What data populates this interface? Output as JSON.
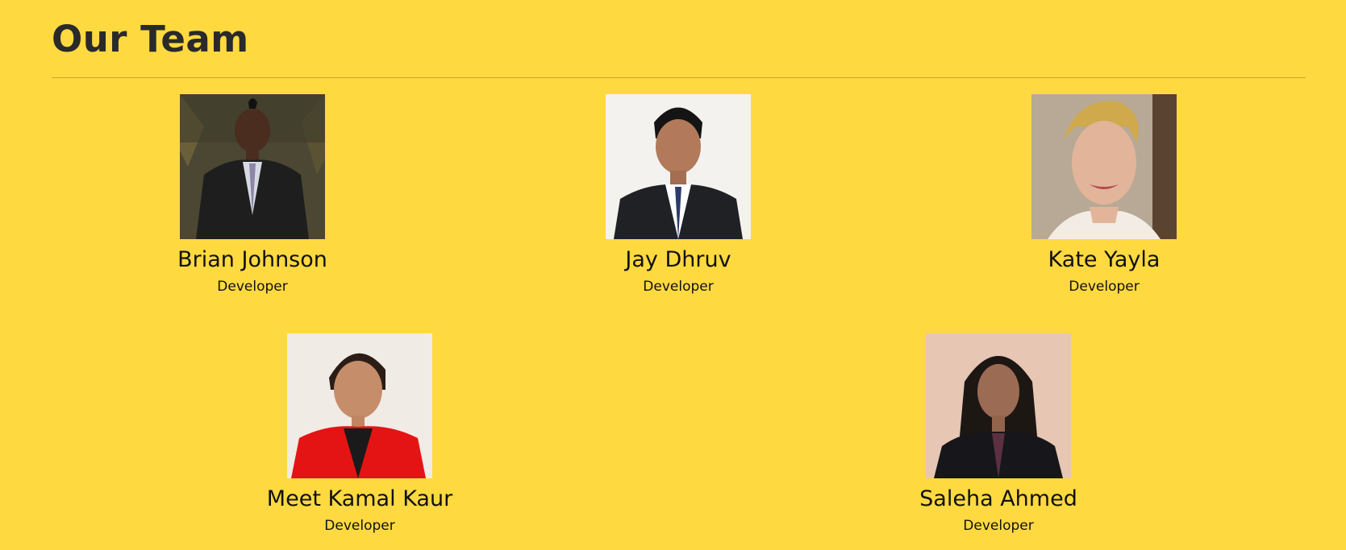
{
  "page": {
    "title": "Our Team",
    "background": "#ffd940"
  },
  "team": {
    "members": [
      {
        "name": "Brian Johnson",
        "role": "Developer",
        "photo_icon": "person-photo-man-dark-suit"
      },
      {
        "name": "Jay Dhruv",
        "role": "Developer",
        "photo_icon": "person-photo-man-navy-suit"
      },
      {
        "name": "Kate Yayla",
        "role": "Developer",
        "photo_icon": "person-photo-woman-blonde"
      },
      {
        "name": "Meet Kamal Kaur",
        "role": "Developer",
        "photo_icon": "person-photo-woman-red-blazer"
      },
      {
        "name": "Saleha Ahmed",
        "role": "Developer",
        "photo_icon": "person-photo-woman-dark-hair"
      }
    ]
  }
}
